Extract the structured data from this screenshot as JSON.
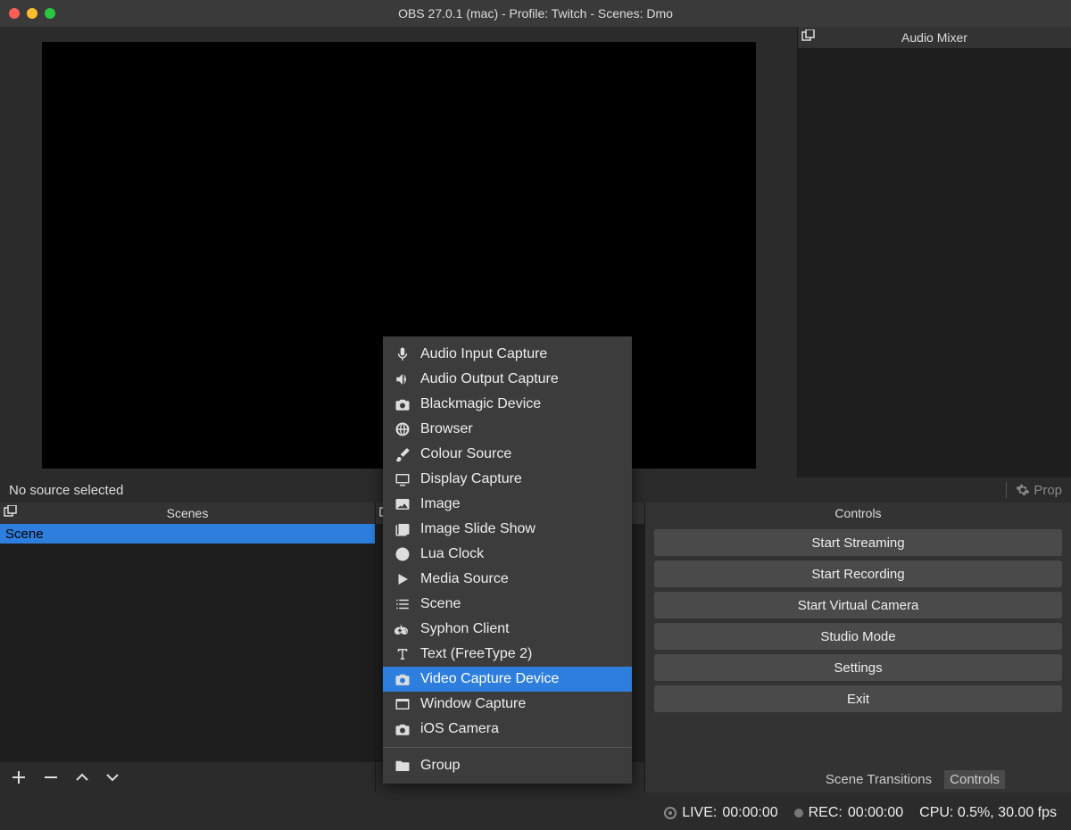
{
  "window": {
    "title": "OBS 27.0.1 (mac) - Profile: Twitch - Scenes: Dmo"
  },
  "mixer": {
    "title": "Audio Mixer"
  },
  "infobar": {
    "no_source": "No source selected",
    "properties": "Prop"
  },
  "scenes": {
    "title": "Scenes",
    "items": [
      "Scene"
    ]
  },
  "controls": {
    "title": "Controls",
    "buttons": [
      "Start Streaming",
      "Start Recording",
      "Start Virtual Camera",
      "Studio Mode",
      "Settings",
      "Exit"
    ]
  },
  "dock_toggle": {
    "transitions": "Scene Transitions",
    "controls": "Controls"
  },
  "status": {
    "live_label": "LIVE:",
    "live_time": "00:00:00",
    "rec_label": "REC:",
    "rec_time": "00:00:00",
    "cpu": "CPU: 0.5%, 30.00 fps"
  },
  "context_menu": {
    "items": [
      {
        "icon": "mic",
        "label": "Audio Input Capture"
      },
      {
        "icon": "speaker",
        "label": "Audio Output Capture"
      },
      {
        "icon": "camera",
        "label": "Blackmagic Device"
      },
      {
        "icon": "globe",
        "label": "Browser"
      },
      {
        "icon": "brush",
        "label": "Colour Source"
      },
      {
        "icon": "monitor",
        "label": "Display Capture"
      },
      {
        "icon": "image",
        "label": "Image"
      },
      {
        "icon": "slideshow",
        "label": "Image Slide Show"
      },
      {
        "icon": "clock",
        "label": "Lua Clock"
      },
      {
        "icon": "play",
        "label": "Media Source"
      },
      {
        "icon": "list",
        "label": "Scene"
      },
      {
        "icon": "gamepad",
        "label": "Syphon Client"
      },
      {
        "icon": "text",
        "label": "Text (FreeType 2)"
      },
      {
        "icon": "camera",
        "label": "Video Capture Device",
        "highlight": true
      },
      {
        "icon": "window",
        "label": "Window Capture"
      },
      {
        "icon": "camera",
        "label": "iOS Camera"
      }
    ],
    "group": {
      "icon": "folder",
      "label": "Group"
    }
  }
}
